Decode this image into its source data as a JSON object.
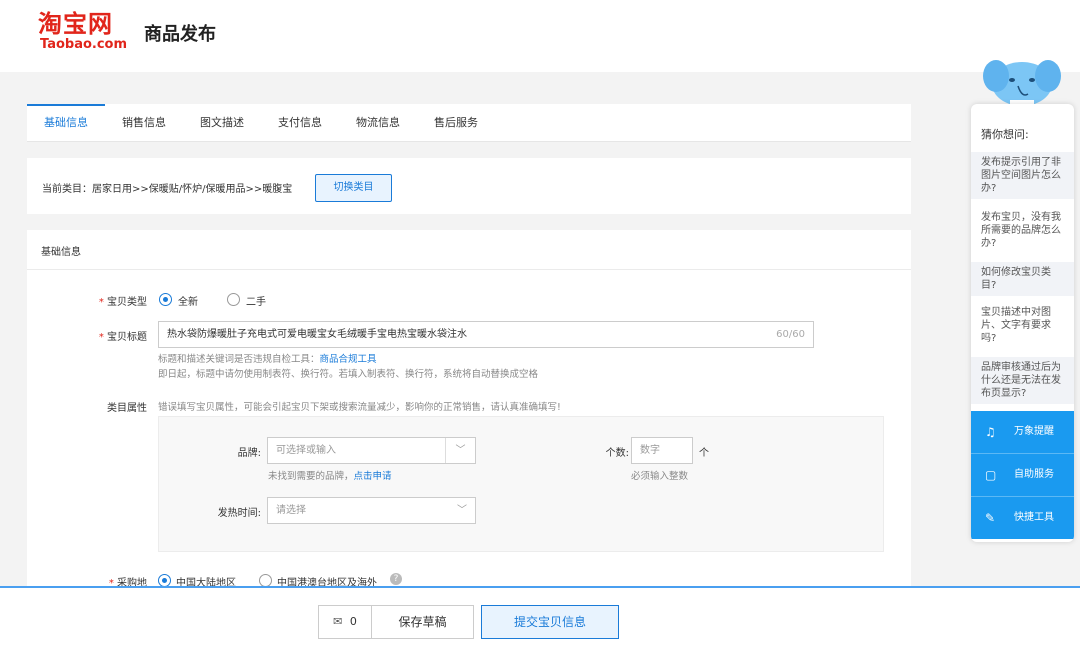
{
  "header": {
    "logo_cn": "淘宝网",
    "logo_en": "Taobao.com",
    "page_title": "商品发布"
  },
  "tabs": [
    {
      "label": "基础信息",
      "active": true
    },
    {
      "label": "销售信息"
    },
    {
      "label": "图文描述"
    },
    {
      "label": "支付信息"
    },
    {
      "label": "物流信息"
    },
    {
      "label": "售后服务"
    }
  ],
  "category": {
    "current": "当前类目：居家日用>>保暖贴/怀炉/保暖用品>>暖腹宝",
    "switch_label": "切换类目"
  },
  "form": {
    "section_title": "基础信息",
    "item_type": {
      "label": "宝贝类型",
      "options": [
        "全新",
        "二手"
      ],
      "selected": "全新"
    },
    "item_title": {
      "label": "宝贝标题",
      "value": "热水袋防爆暖肚子充电式可爱电暖宝女毛绒暖手宝电热宝暖水袋注水",
      "count": "60/60",
      "hint1_prefix": "标题和描述关键词是否违规自检工具：",
      "hint1_link": "商品合规工具",
      "hint2": "即日起，标题中请勿使用制表符、换行符。若填入制表符、换行符，系统将自动替换成空格"
    },
    "attributes": {
      "label": "类目属性",
      "warning": "错误填写宝贝属性，可能会引起宝贝下架或搜索流量减少，影响你的正常销售，请认真准确填写!",
      "brand_label": "品牌:",
      "brand_placeholder": "可选择或输入",
      "brand_hint_prefix": "未找到需要的品牌，",
      "brand_hint_link": "点击申请",
      "count_label": "个数:",
      "count_placeholder": "数字",
      "count_unit": "个",
      "count_hint": "必须输入整数",
      "heat_time_label": "发热时间:",
      "heat_time_placeholder": "请选择"
    },
    "origin": {
      "label": "采购地",
      "options": [
        "中国大陆地区",
        "中国港澳台地区及海外"
      ],
      "selected": "中国大陆地区"
    }
  },
  "bottom": {
    "mail_count": "0",
    "save_draft": "保存草稿",
    "submit": "提交宝贝信息"
  },
  "assistant": {
    "title": "猜你想问:",
    "questions": [
      "发布提示引用了非图片空间图片怎么办?",
      "发布宝贝，没有我所需要的品牌怎么办?",
      "如何修改宝贝类目?",
      "宝贝描述中对图片、文字有要求吗?",
      "品牌审核通过后为什么还是无法在发布页显示?"
    ],
    "buttons": [
      "万象提醒",
      "自助服务",
      "快捷工具"
    ]
  },
  "colors": {
    "brand_red": "#e1251b",
    "accent_blue": "#1a7bd8",
    "assist_blue": "#1a9af0"
  }
}
